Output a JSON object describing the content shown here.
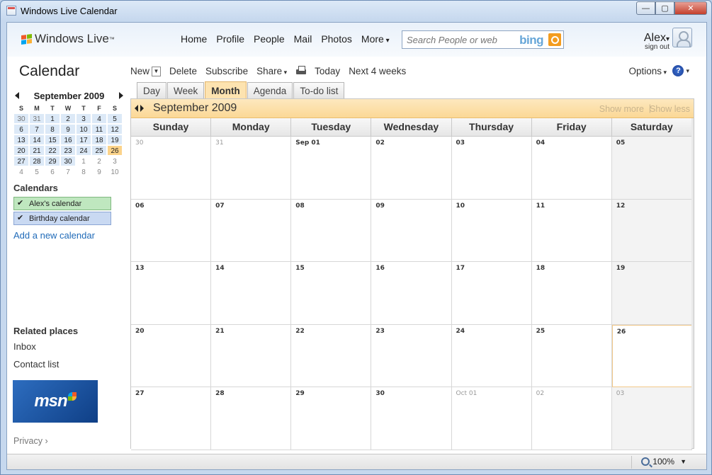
{
  "window": {
    "title": "Windows Live Calendar",
    "min_glyph": "—",
    "max_glyph": "▢",
    "close_glyph": "✕"
  },
  "header": {
    "logo_text": "Windows Live",
    "logo_tm": "™",
    "nav": [
      "Home",
      "Profile",
      "People",
      "Mail",
      "Photos",
      "More"
    ],
    "search_placeholder": "Search People or web",
    "search_brand": "bing",
    "user_name": "Alex",
    "signout": "sign out"
  },
  "page_title": "Calendar",
  "toolbar": {
    "new": "New",
    "new_caret": "▼",
    "delete": "Delete",
    "subscribe": "Subscribe",
    "share": "Share",
    "today": "Today",
    "next4": "Next 4 weeks",
    "options": "Options",
    "help": "?",
    "help_caret": "▾"
  },
  "tabs": [
    {
      "label": "Day",
      "active": false
    },
    {
      "label": "Week",
      "active": false
    },
    {
      "label": "Month",
      "active": true
    },
    {
      "label": "Agenda",
      "active": false
    },
    {
      "label": "To-do list",
      "active": false
    }
  ],
  "mini_calendar": {
    "title": "September 2009",
    "dow": [
      "S",
      "M",
      "T",
      "W",
      "T",
      "F",
      "S"
    ],
    "weeks": [
      [
        {
          "d": "30",
          "t": "prevm"
        },
        {
          "d": "31",
          "t": "prevm"
        },
        {
          "d": "1",
          "t": "cur"
        },
        {
          "d": "2",
          "t": "cur"
        },
        {
          "d": "3",
          "t": "cur"
        },
        {
          "d": "4",
          "t": "cur"
        },
        {
          "d": "5",
          "t": "cur"
        }
      ],
      [
        {
          "d": "6",
          "t": "cur"
        },
        {
          "d": "7",
          "t": "cur"
        },
        {
          "d": "8",
          "t": "cur"
        },
        {
          "d": "9",
          "t": "cur"
        },
        {
          "d": "10",
          "t": "cur"
        },
        {
          "d": "11",
          "t": "cur"
        },
        {
          "d": "12",
          "t": "cur"
        }
      ],
      [
        {
          "d": "13",
          "t": "cur"
        },
        {
          "d": "14",
          "t": "cur"
        },
        {
          "d": "15",
          "t": "cur"
        },
        {
          "d": "16",
          "t": "cur"
        },
        {
          "d": "17",
          "t": "cur"
        },
        {
          "d": "18",
          "t": "cur"
        },
        {
          "d": "19",
          "t": "cur"
        }
      ],
      [
        {
          "d": "20",
          "t": "cur"
        },
        {
          "d": "21",
          "t": "cur"
        },
        {
          "d": "22",
          "t": "cur"
        },
        {
          "d": "23",
          "t": "cur"
        },
        {
          "d": "24",
          "t": "cur"
        },
        {
          "d": "25",
          "t": "cur"
        },
        {
          "d": "26",
          "t": "today"
        }
      ],
      [
        {
          "d": "27",
          "t": "cur"
        },
        {
          "d": "28",
          "t": "cur"
        },
        {
          "d": "29",
          "t": "cur"
        },
        {
          "d": "30",
          "t": "cur"
        },
        {
          "d": "1",
          "t": "other"
        },
        {
          "d": "2",
          "t": "other"
        },
        {
          "d": "3",
          "t": "other"
        }
      ],
      [
        {
          "d": "4",
          "t": "other"
        },
        {
          "d": "5",
          "t": "other"
        },
        {
          "d": "6",
          "t": "other"
        },
        {
          "d": "7",
          "t": "other"
        },
        {
          "d": "8",
          "t": "other"
        },
        {
          "d": "9",
          "t": "other"
        },
        {
          "d": "10",
          "t": "other"
        }
      ]
    ]
  },
  "calendars": {
    "heading": "Calendars",
    "items": [
      {
        "label": "Alex's calendar",
        "checked": true,
        "color": "#bfe7bf"
      },
      {
        "label": "Birthday calendar",
        "checked": true,
        "color": "#c9d9f2"
      }
    ],
    "add_link": "Add a new calendar",
    "check_glyph": "✔"
  },
  "related": {
    "heading": "Related places",
    "links": [
      "Inbox",
      "Contact list"
    ]
  },
  "ad": {
    "text": "msn"
  },
  "privacy": "Privacy",
  "month_view": {
    "title": "September 2009",
    "show_more": "Show more",
    "separator": "|",
    "show_less": "Show less",
    "weekdays": [
      "Sunday",
      "Monday",
      "Tuesday",
      "Wednesday",
      "Thursday",
      "Friday",
      "Saturday"
    ],
    "weeks": [
      [
        {
          "d": "30",
          "other": true
        },
        {
          "d": "31",
          "other": true
        },
        {
          "d": "Sep 01"
        },
        {
          "d": "02"
        },
        {
          "d": "03"
        },
        {
          "d": "04"
        },
        {
          "d": "05"
        }
      ],
      [
        {
          "d": "06"
        },
        {
          "d": "07"
        },
        {
          "d": "08"
        },
        {
          "d": "09"
        },
        {
          "d": "10"
        },
        {
          "d": "11"
        },
        {
          "d": "12"
        }
      ],
      [
        {
          "d": "13"
        },
        {
          "d": "14"
        },
        {
          "d": "15"
        },
        {
          "d": "16"
        },
        {
          "d": "17"
        },
        {
          "d": "18"
        },
        {
          "d": "19"
        }
      ],
      [
        {
          "d": "20"
        },
        {
          "d": "21"
        },
        {
          "d": "22"
        },
        {
          "d": "23"
        },
        {
          "d": "24"
        },
        {
          "d": "25"
        },
        {
          "d": "26",
          "today": true
        }
      ],
      [
        {
          "d": "27"
        },
        {
          "d": "28"
        },
        {
          "d": "29"
        },
        {
          "d": "30"
        },
        {
          "d": "Oct 01",
          "other": true
        },
        {
          "d": "02",
          "other": true
        },
        {
          "d": "03",
          "other": true
        }
      ]
    ]
  },
  "statusbar": {
    "zoom": "100%",
    "zoom_caret": "▼"
  },
  "colors": {
    "accent": "#1f6ab8",
    "today": "#fbd38a",
    "month_bar": "#fbd896"
  }
}
